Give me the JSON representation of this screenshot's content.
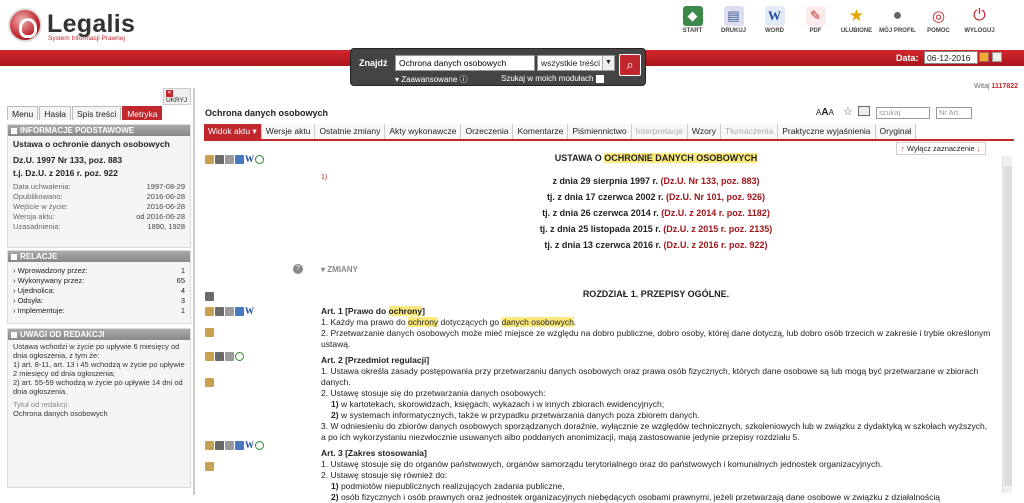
{
  "app": {
    "title": "Legalis",
    "subtitle": "System Informacji Prawnej"
  },
  "toolbar": [
    {
      "label": "START",
      "icon": "start-icon",
      "color": "#3b8a4a"
    },
    {
      "label": "DRUKUJ",
      "icon": "print-icon",
      "color": "#3a5a9a"
    },
    {
      "label": "WORD",
      "icon": "word-icon",
      "color": "#1c4ea0"
    },
    {
      "label": "PDF",
      "icon": "pdf-icon",
      "color": "#c1272d"
    },
    {
      "label": "ULUBIONE",
      "icon": "star-icon",
      "color": "#e0a800"
    },
    {
      "label": "MÓJ PROFIL",
      "icon": "user-icon",
      "color": "#666"
    },
    {
      "label": "POMOC",
      "icon": "help-icon",
      "color": "#c1272d"
    },
    {
      "label": "WYLOGUJ",
      "icon": "power-icon",
      "color": "#c1272d"
    }
  ],
  "search": {
    "label": "Znajdź",
    "value": "Ochrona danych osobowych",
    "scope": "wszystkie treści",
    "advanced": "Zaawansowane",
    "my_modules": "Szukaj w moich modułach"
  },
  "date": {
    "label": "Data:",
    "value": "06-12-2016"
  },
  "welcome": {
    "text": "Witaj",
    "user": "1117822"
  },
  "left": {
    "hide": "UKRYJ",
    "tabs": [
      "Menu",
      "Hasła",
      "Spis treści",
      "Metryka"
    ],
    "active_tab": "Metryka",
    "basic": {
      "header": "INFORMACJE PODSTAWOWE",
      "title": "Ustawa o ochronie danych osobowych",
      "ref1": "Dz.U. 1997 Nr 133, poz. 883",
      "ref2": "t.j. Dz.U. z 2016 r. poz. 922",
      "rows": [
        {
          "k": "Data uchwalenia:",
          "v": "1997-08-29"
        },
        {
          "k": "Opublikowano:",
          "v": "2016-06-28"
        },
        {
          "k": "Wejście w życie:",
          "v": "2016-06-28"
        },
        {
          "k": "Wersja aktu:",
          "v": "od 2016-06-28"
        },
        {
          "k": "Uzasadnienia:",
          "v": "1890, 1928"
        }
      ]
    },
    "relations": {
      "header": "RELACJE",
      "rows": [
        {
          "k": "Wprowadzony przez:",
          "v": "1"
        },
        {
          "k": "Wykonywany przez:",
          "v": "65"
        },
        {
          "k": "Ujednolica:",
          "v": "4"
        },
        {
          "k": "Odsyła:",
          "v": "3"
        },
        {
          "k": "Implementuje:",
          "v": "1"
        }
      ]
    },
    "notes": {
      "header": "UWAGI OD REDAKCJI",
      "text1": "Ustawa wchodzi w życie po upływie 6 miesięcy od dnia ogłoszenia, z tym że:",
      "text2": "1) art. 8-11, art. 13 i 45 wchodzą w życie po upływie 2 miesięcy od dnia ogłoszenia;",
      "text3": "2) art. 55-59 wchodzą w życie po upływie 14 dni od dnia ogłoszenia.",
      "title_label": "Tytuł od redakcji:",
      "title_value": "Ochrona danych osobowych"
    }
  },
  "main": {
    "title": "Ochrona danych osobowych",
    "szukaj": "szukaj",
    "nrart": "Nr Art.",
    "tabs": [
      "Widok aktu",
      "Wersje aktu",
      "Ostatnie zmiany",
      "Akty wykonawcze",
      "Orzeczenia",
      "Komentarze",
      "Piśmiennictwo",
      "Interpretacje",
      "Wzory",
      "Tłumaczenia",
      "Praktyczne wyjaśnienia",
      "Oryginał"
    ],
    "highlight_off": "Wyłącz zaznaczenie",
    "heading_pre": "USTAWA O ",
    "heading_hl": "OCHRONIE DANYCH OSOBOWYCH",
    "fn": "1)",
    "dates": [
      {
        "t": "z dnia 29 sierpnia 1997 r.",
        "r": "(Dz.U. Nr 133, poz. 883)"
      },
      {
        "t": "tj. z dnia 17 czerwca 2002 r.",
        "r": "(Dz.U. Nr 101, poz. 926)"
      },
      {
        "t": "tj. z dnia 26 czerwca 2014 r.",
        "r": "(Dz.U. z 2014 r. poz. 1182)"
      },
      {
        "t": "tj. z dnia 25 listopada 2015 r.",
        "r": "(Dz.U. z 2015 r. poz. 2135)"
      },
      {
        "t": "tj. z dnia 13 czerwca 2016 r.",
        "r": "(Dz.U. z 2016 r. poz. 922)"
      }
    ],
    "zmiany": "ZMIANY",
    "chapter": "ROZDZIAŁ 1. PRZEPISY OGÓLNE.",
    "a1_head_pre": "Art. 1 [Prawo do ",
    "a1_head_hl": "ochrony",
    "a1_head_post": "]",
    "a1_1_pre": "1. Każdy ma prawo do ",
    "a1_1_hl1": "ochrony",
    "a1_1_mid": " dotyczących go ",
    "a1_1_hl2": "danych osobowych",
    "a1_1_post": ".",
    "a1_2": "2. Przetwarzanie danych osobowych może mieć miejsce ze względu na dobro publiczne, dobro osoby, której dane dotyczą, lub dobro osób trzecich w zakresie i trybie określonym ustawą.",
    "a2_head": "Art. 2 [Przedmiot regulacji]",
    "a2_1": "1. Ustawa określa zasady postępowania przy przetwarzaniu danych osobowych oraz prawa osób fizycznych, których dane osobowe są lub mogą być przetwarzane w zbiorach danych.",
    "a2_2": "2. Ustawę stosuje się do przetwarzania danych osobowych:",
    "a2_2_1": "w kartotekach, skorowidzach, księgach, wykazach i w innych zbiorach ewidencyjnych;",
    "a2_2_2": "w systemach informatycznych, także w przypadku przetwarzania danych poza zbiorem danych.",
    "a2_3": "3. W odniesieniu do zbiorów danych osobowych sporządzanych doraźnie, wyłącznie ze względów technicznych, szkoleniowych lub w związku z dydaktyką w szkołach wyższych, a po ich wykorzystaniu niezwłocznie usuwanych albo poddanych anonimizacji, mają zastosowanie jedynie przepisy rozdziału 5.",
    "a3_head": "Art. 3 [Zakres stosowania]",
    "a3_1": "1. Ustawę stosuje się do organów państwowych, organów samorządu terytorialnego oraz do państwowych i komunalnych jednostek organizacyjnych.",
    "a3_2": "2. Ustawę stosuje się również do:",
    "a3_2_1": "podmiotów niepublicznych realizujących zadania publiczne,",
    "a3_2_2": "osób fizycznych i osób prawnych oraz jednostek organizacyjnych niebędących osobami prawnymi, jeżeli przetwarzają dane osobowe w związku z działalnością"
  }
}
